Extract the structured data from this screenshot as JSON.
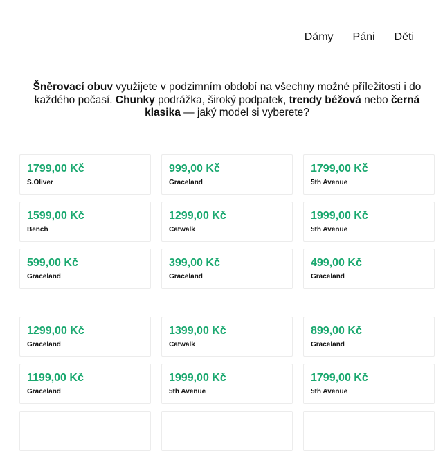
{
  "nav": {
    "items": [
      {
        "label": "Dámy"
      },
      {
        "label": "Páni"
      },
      {
        "label": "Děti"
      }
    ]
  },
  "intro": {
    "p1_bold": "Šněrovací obuv",
    "p1_text": " využijete v podzimním období na všechny možné příležitosti i do každého počasí. ",
    "p2_bold": "Chunky",
    "p2_text": " podrážka, široký podpatek, ",
    "p3_bold": "trendy béžová",
    "p3_text": " nebo ",
    "p4_bold": "černá klasika",
    "p4_text": " — jaký model si vyberete?"
  },
  "colors": {
    "price": "#1aa86f",
    "border": "#ececec"
  },
  "products_top": [
    {
      "price": "1799,00 Kč",
      "brand": "S.Oliver"
    },
    {
      "price": "999,00 Kč",
      "brand": "Graceland"
    },
    {
      "price": "1799,00 Kč",
      "brand": "5th Avenue"
    },
    {
      "price": "1599,00 Kč",
      "brand": "Bench"
    },
    {
      "price": "1299,00 Kč",
      "brand": "Catwalk"
    },
    {
      "price": "1999,00 Kč",
      "brand": "5th Avenue"
    },
    {
      "price": "599,00 Kč",
      "brand": "Graceland"
    },
    {
      "price": "399,00 Kč",
      "brand": "Graceland"
    },
    {
      "price": "499,00 Kč",
      "brand": "Graceland"
    }
  ],
  "products_bottom": [
    {
      "price": "1299,00 Kč",
      "brand": "Graceland"
    },
    {
      "price": "1399,00 Kč",
      "brand": "Catwalk"
    },
    {
      "price": "899,00 Kč",
      "brand": "Graceland"
    },
    {
      "price": "1199,00 Kč",
      "brand": "Graceland"
    },
    {
      "price": "1999,00 Kč",
      "brand": "5th Avenue"
    },
    {
      "price": "1799,00 Kč",
      "brand": "5th Avenue"
    },
    {
      "price": "",
      "brand": ""
    },
    {
      "price": "",
      "brand": ""
    },
    {
      "price": "",
      "brand": ""
    }
  ]
}
